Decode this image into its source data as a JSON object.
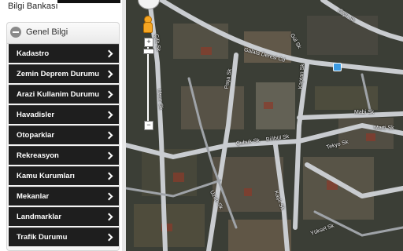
{
  "brand": {
    "text": "Bilgi Bankası"
  },
  "panel": {
    "title": "Genel Bilgi",
    "items": [
      {
        "label": "Kadastro"
      },
      {
        "label": "Zemin Deprem Durumu"
      },
      {
        "label": "Arazi Kullanim Durumu"
      },
      {
        "label": "Havadisler"
      },
      {
        "label": "Otoparklar"
      },
      {
        "label": "Rekreasyon"
      },
      {
        "label": "Kamu Kurumları"
      },
      {
        "label": "Mekanlar"
      },
      {
        "label": "Landmarklar"
      },
      {
        "label": "Trafik Durumu"
      }
    ]
  },
  "map": {
    "zoom_in": "+",
    "zoom_out": "−",
    "streets": {
      "s1": "Galata Deresi Cd",
      "s2": "Çifit Sk",
      "s3": "Uzun Sk",
      "s4": "Paşa Sk",
      "s5": "Kaptan Sk",
      "s6": "Mabi Sk",
      "s7": "Marti Sk",
      "s8": "Tekyo Sk",
      "s9": "Çubuk Sk",
      "s10": "Bülbül Sk",
      "s11": "Uzun Sk",
      "s12": "Kaşlı Sk",
      "s13": "Yüksel Sk",
      "s14": "Gül Sk",
      "s15": "Ölçü Sk"
    }
  },
  "colors": {
    "menu_bg": "#1e1e1e",
    "map_bg": "#3b3e36",
    "road": "#c9ccd0",
    "pegman": "#f6a623"
  }
}
